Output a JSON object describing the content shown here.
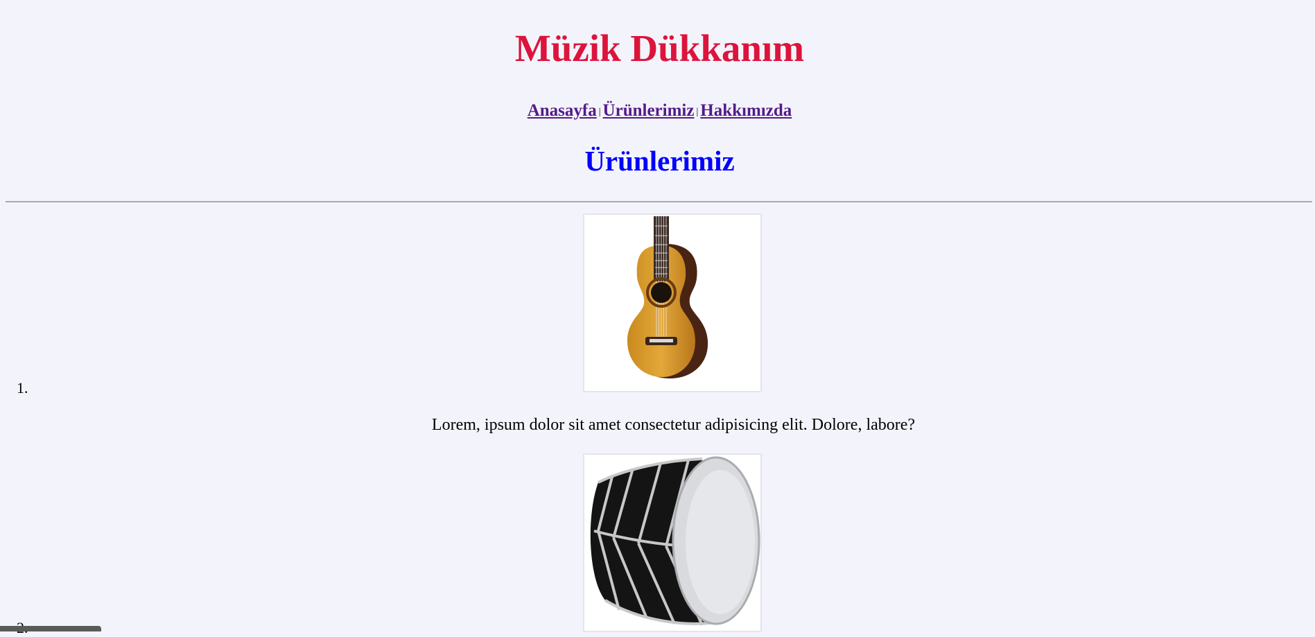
{
  "site": {
    "title": "Müzik Dükkanım"
  },
  "nav": {
    "items": [
      {
        "label": "Anasayfa"
      },
      {
        "label": "Ürünlerimiz"
      },
      {
        "label": "Hakkımızda"
      }
    ],
    "separator": "|"
  },
  "page": {
    "heading": "Ürünlerimiz"
  },
  "products": [
    {
      "number": "1.",
      "image_icon": "guitar-icon",
      "description": "Lorem, ipsum dolor sit amet consectetur adipisicing elit. Dolore, labore?"
    },
    {
      "number": "2.",
      "image_icon": "drum-icon"
    }
  ],
  "colors": {
    "title": "#dc143c",
    "nav_link": "#551a8b",
    "heading": "#0000ff",
    "background": "#f3f4fb"
  }
}
